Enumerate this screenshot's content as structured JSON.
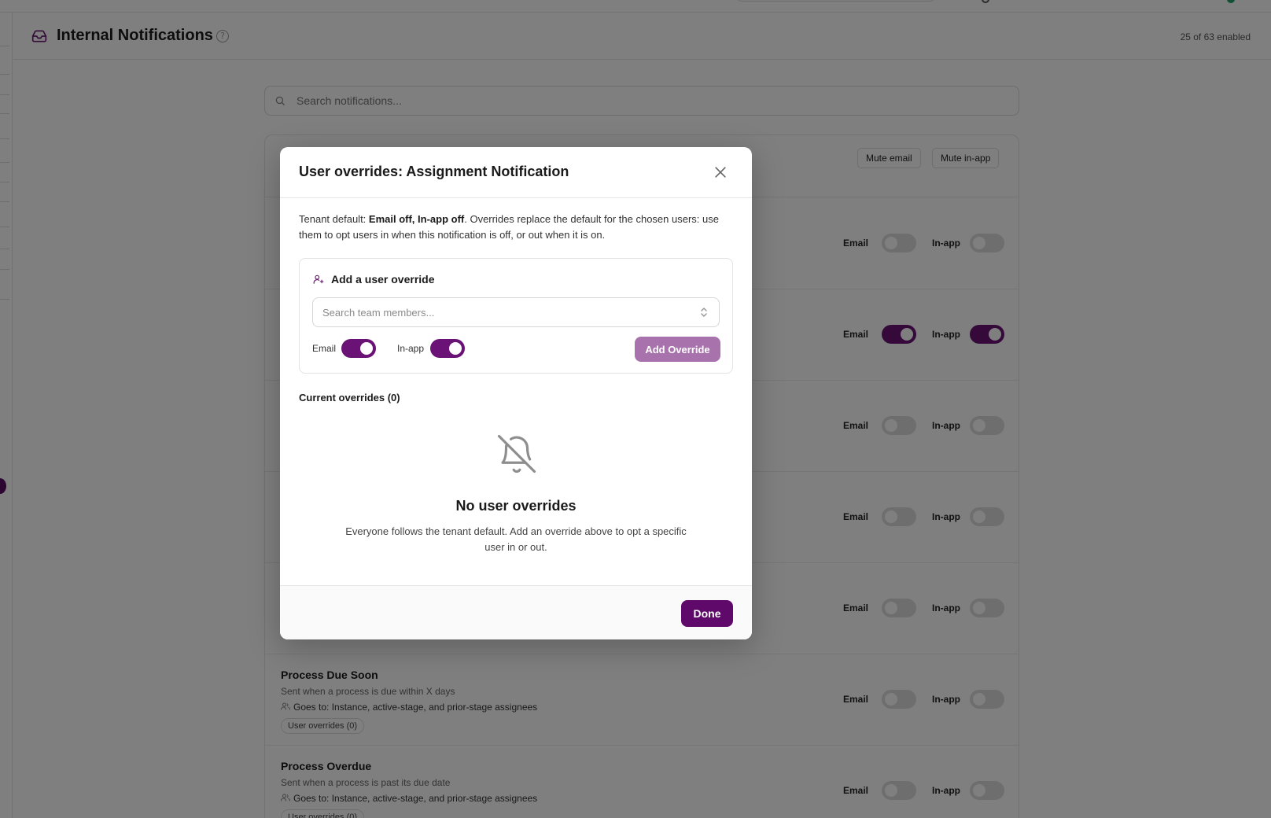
{
  "header": {
    "title": "Internal Notifications",
    "enabled_count": "25 of 63 enabled"
  },
  "search": {
    "placeholder": "Search notifications..."
  },
  "card": {
    "mute_email": "Mute email",
    "mute_inapp": "Mute in-app"
  },
  "toggle_labels": {
    "email": "Email",
    "inapp": "In-app"
  },
  "rows": [
    {
      "email_on": false,
      "inapp_on": false
    },
    {
      "email_on": true,
      "inapp_on": true
    },
    {
      "email_on": false,
      "inapp_on": false
    },
    {
      "email_on": false,
      "inapp_on": false
    },
    {
      "email_on": false,
      "inapp_on": false
    },
    {
      "title": "Process Due Soon",
      "desc": "Sent when a process is due within X days",
      "goes_to": "Goes to: Instance, active-stage, and prior-stage assignees",
      "overrides": "User overrides (0)",
      "email_on": false,
      "inapp_on": false
    },
    {
      "title": "Process Overdue",
      "desc": "Sent when a process is past its due date",
      "goes_to": "Goes to: Instance, active-stage, and prior-stage assignees",
      "overrides": "User overrides (0)",
      "email_on": false,
      "inapp_on": false
    }
  ],
  "modal": {
    "title": "User overrides: Assignment Notification",
    "desc_prefix": "Tenant default: ",
    "desc_default": "Email off, In-app off",
    "desc_suffix": ". Overrides replace the default for the chosen users: use them to opt users in when this notification is off, or out when it is on.",
    "add_title": "Add a user override",
    "member_placeholder": "Search team members...",
    "email_label": "Email",
    "inapp_label": "In-app",
    "email_on": true,
    "inapp_on": true,
    "add_button": "Add Override",
    "current_title": "Current overrides (0)",
    "empty_title": "No user overrides",
    "empty_desc": "Everyone follows the tenant default. Add an override above to opt a specific user in or out.",
    "done_button": "Done"
  },
  "colors": {
    "brand": "#5f0a6b",
    "toggle_on": "#6a1275",
    "add_button_disabled": "#a873ad"
  }
}
